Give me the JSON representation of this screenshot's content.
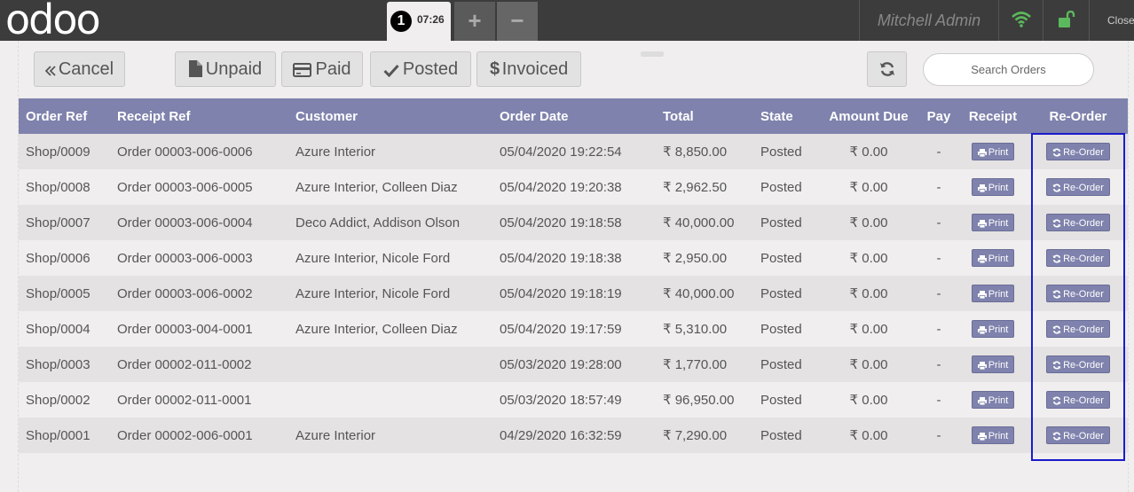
{
  "topbar": {
    "logo": "odoo",
    "order_tab": {
      "number": "1",
      "time": "07:26"
    },
    "add_label": "+",
    "remove_label": "−",
    "user": "Mitchell Admin",
    "close_label": "Close"
  },
  "toolbar": {
    "cancel_label": "Cancel",
    "unpaid_label": "Unpaid",
    "paid_label": "Paid",
    "posted_label": "Posted",
    "invoiced_label": "Invoiced",
    "search_placeholder": "Search Orders"
  },
  "table": {
    "headers": [
      "Order Ref",
      "Receipt Ref",
      "Customer",
      "Order Date",
      "Total",
      "State",
      "Amount Due",
      "Pay",
      "Receipt",
      "Re-Order"
    ],
    "print_label": "Print",
    "reorder_label": "Re-Order",
    "rows": [
      {
        "order_ref": "Shop/0009",
        "receipt_ref": "Order 00003-006-0006",
        "customer": "Azure Interior",
        "date": "05/04/2020 19:22:54",
        "total": "₹ 8,850.00",
        "state": "Posted",
        "due": "₹ 0.00",
        "pay": "-"
      },
      {
        "order_ref": "Shop/0008",
        "receipt_ref": "Order 00003-006-0005",
        "customer": "Azure Interior, Colleen Diaz",
        "date": "05/04/2020 19:20:38",
        "total": "₹ 2,962.50",
        "state": "Posted",
        "due": "₹ 0.00",
        "pay": "-"
      },
      {
        "order_ref": "Shop/0007",
        "receipt_ref": "Order 00003-006-0004",
        "customer": "Deco Addict, Addison Olson",
        "date": "05/04/2020 19:18:58",
        "total": "₹ 40,000.00",
        "state": "Posted",
        "due": "₹ 0.00",
        "pay": "-"
      },
      {
        "order_ref": "Shop/0006",
        "receipt_ref": "Order 00003-006-0003",
        "customer": "Azure Interior, Nicole Ford",
        "date": "05/04/2020 19:18:38",
        "total": "₹ 2,950.00",
        "state": "Posted",
        "due": "₹ 0.00",
        "pay": "-"
      },
      {
        "order_ref": "Shop/0005",
        "receipt_ref": "Order 00003-006-0002",
        "customer": "Azure Interior, Nicole Ford",
        "date": "05/04/2020 19:18:19",
        "total": "₹ 40,000.00",
        "state": "Posted",
        "due": "₹ 0.00",
        "pay": "-"
      },
      {
        "order_ref": "Shop/0004",
        "receipt_ref": "Order 00003-004-0001",
        "customer": "Azure Interior, Colleen Diaz",
        "date": "05/04/2020 19:17:59",
        "total": "₹ 5,310.00",
        "state": "Posted",
        "due": "₹ 0.00",
        "pay": "-"
      },
      {
        "order_ref": "Shop/0003",
        "receipt_ref": "Order 00002-011-0002",
        "customer": "",
        "date": "05/03/2020 19:28:00",
        "total": "₹ 1,770.00",
        "state": "Posted",
        "due": "₹ 0.00",
        "pay": "-"
      },
      {
        "order_ref": "Shop/0002",
        "receipt_ref": "Order 00002-011-0001",
        "customer": "",
        "date": "05/03/2020 18:57:49",
        "total": "₹ 96,950.00",
        "state": "Posted",
        "due": "₹ 0.00",
        "pay": "-"
      },
      {
        "order_ref": "Shop/0001",
        "receipt_ref": "Order 00002-006-0001",
        "customer": "Azure Interior",
        "date": "04/29/2020 16:32:59",
        "total": "₹ 7,290.00",
        "state": "Posted",
        "due": "₹ 0.00",
        "pay": "-"
      }
    ]
  },
  "colors": {
    "header_bg": "#7f82ac",
    "topbar_bg": "#3c3c3c",
    "wifi": "#5cb85c",
    "lock": "#5cb85c",
    "highlight": "#1a1acc"
  },
  "icons": [
    "angle-double-left-icon",
    "file-icon",
    "credit-card-icon",
    "check-icon",
    "dollar-icon",
    "refresh-icon",
    "wifi-icon",
    "unlock-icon",
    "print-icon"
  ]
}
